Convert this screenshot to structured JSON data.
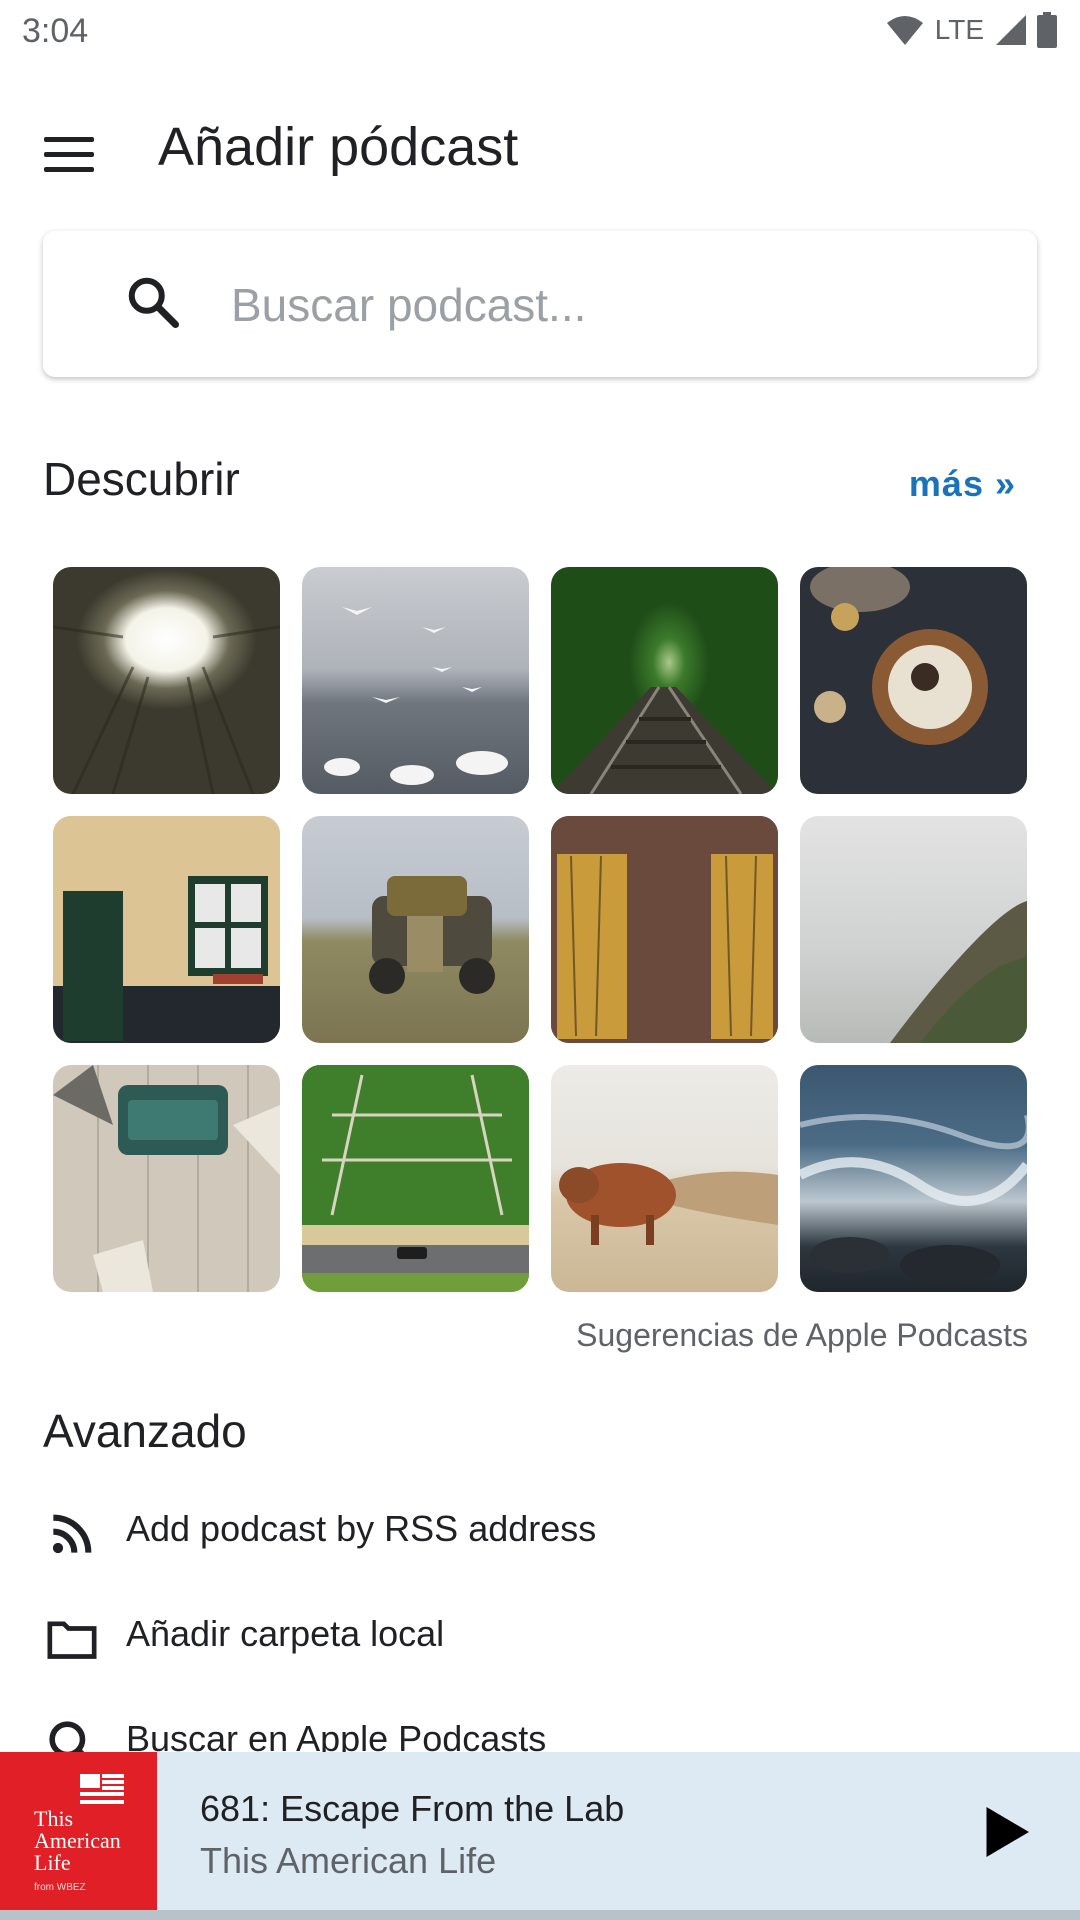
{
  "status_bar": {
    "time": "3:04",
    "network": "LTE"
  },
  "app_bar": {
    "title": "Añadir pódcast"
  },
  "search": {
    "placeholder": "Buscar podcast..."
  },
  "discover": {
    "title": "Descubrir",
    "more_label": "más »",
    "caption": "Sugerencias de Apple Podcasts",
    "tiles": [
      "building-courtyard-image",
      "seagulls-swans-image",
      "railway-forest-image",
      "food-table-image",
      "brick-house-door-image",
      "old-truck-field-image",
      "rusty-shutters-image",
      "foggy-cliff-image",
      "typewriter-desk-image",
      "green-field-road-image",
      "highland-cow-beach-image",
      "ocean-waves-image"
    ]
  },
  "advanced": {
    "title": "Avanzado",
    "items": [
      {
        "label": "Add podcast by RSS address",
        "icon": "rss-icon"
      },
      {
        "label": "Añadir carpeta local",
        "icon": "folder-icon"
      },
      {
        "label": "Buscar en Apple Podcasts",
        "icon": "search-icon"
      }
    ]
  },
  "player": {
    "episode": "681: Escape From the Lab",
    "show": "This American Life",
    "art_text": [
      "This",
      "American",
      "Life"
    ],
    "art_sub": "from WBEZ"
  },
  "colors": {
    "accent": "#1a73b8",
    "player_bg": "#deeaf3",
    "art_red": "#e01f26"
  }
}
